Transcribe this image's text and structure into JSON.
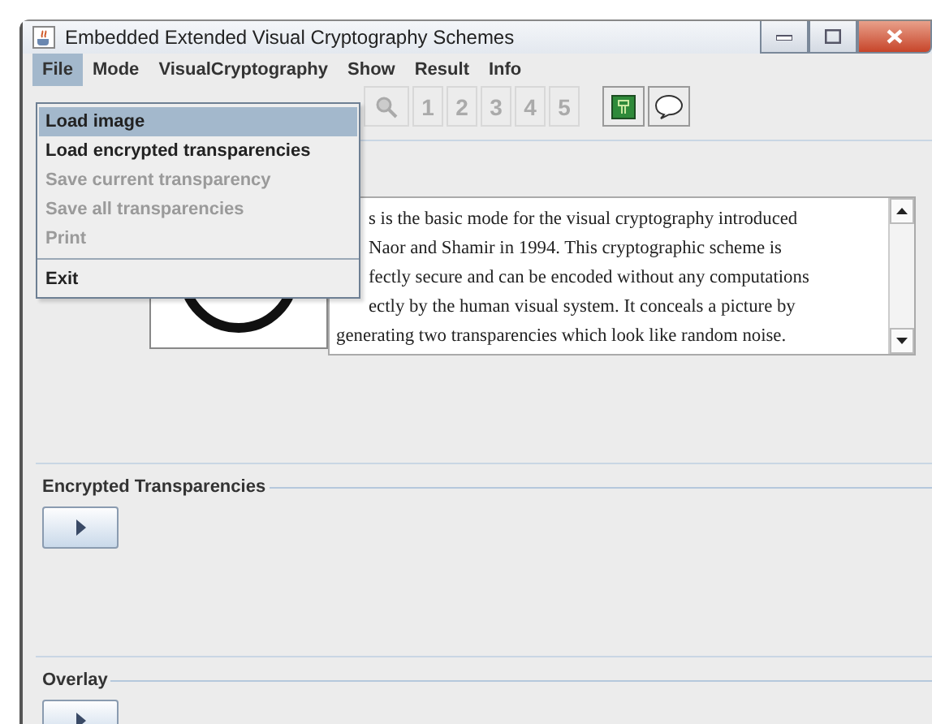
{
  "window": {
    "title": "Embedded Extended Visual Cryptography Schemes"
  },
  "menu_bar": [
    {
      "label": "File",
      "selected": true
    },
    {
      "label": "Mode",
      "selected": false
    },
    {
      "label": "VisualCryptography",
      "selected": false
    },
    {
      "label": "Show",
      "selected": false
    },
    {
      "label": "Result",
      "selected": false
    },
    {
      "label": "Info",
      "selected": false
    }
  ],
  "file_menu": [
    {
      "kind": "item",
      "label": "Load image",
      "selected": true,
      "disabled": false
    },
    {
      "kind": "item",
      "label": "Load encrypted transparencies",
      "selected": false,
      "disabled": false
    },
    {
      "kind": "item",
      "label": "Save current transparency",
      "selected": false,
      "disabled": true
    },
    {
      "kind": "item",
      "label": "Save all transparencies",
      "selected": false,
      "disabled": true
    },
    {
      "kind": "item",
      "label": "Print",
      "selected": false,
      "disabled": true
    },
    {
      "kind": "separator"
    },
    {
      "kind": "item",
      "label": "Exit",
      "selected": false,
      "disabled": false
    }
  ],
  "toolbar": [
    {
      "kind": "zoom",
      "disabled": true
    },
    {
      "kind": "number",
      "label": "1",
      "disabled": true
    },
    {
      "kind": "number",
      "label": "2",
      "disabled": true
    },
    {
      "kind": "number",
      "label": "3",
      "disabled": true
    },
    {
      "kind": "number",
      "label": "4",
      "disabled": true
    },
    {
      "kind": "number",
      "label": "5",
      "disabled": true
    },
    {
      "kind": "gap"
    },
    {
      "kind": "green",
      "disabled": false
    },
    {
      "kind": "bubble",
      "disabled": false
    }
  ],
  "description_lines": [
    {
      "text": "s is the basic mode for the visual cryptography introduced",
      "covered": true
    },
    {
      "text": "Naor and Shamir in 1994. This cryptographic scheme is",
      "covered": true
    },
    {
      "text": "fectly secure and can be encoded without any computations",
      "covered": true
    },
    {
      "text": "ectly by the human visual system. It conceals a picture by",
      "covered": true
    },
    {
      "text": "generating two transparencies which look like random noise.",
      "covered": false
    }
  ],
  "sections": [
    {
      "title": "Encrypted Transparencies"
    },
    {
      "title": "Overlay"
    }
  ]
}
